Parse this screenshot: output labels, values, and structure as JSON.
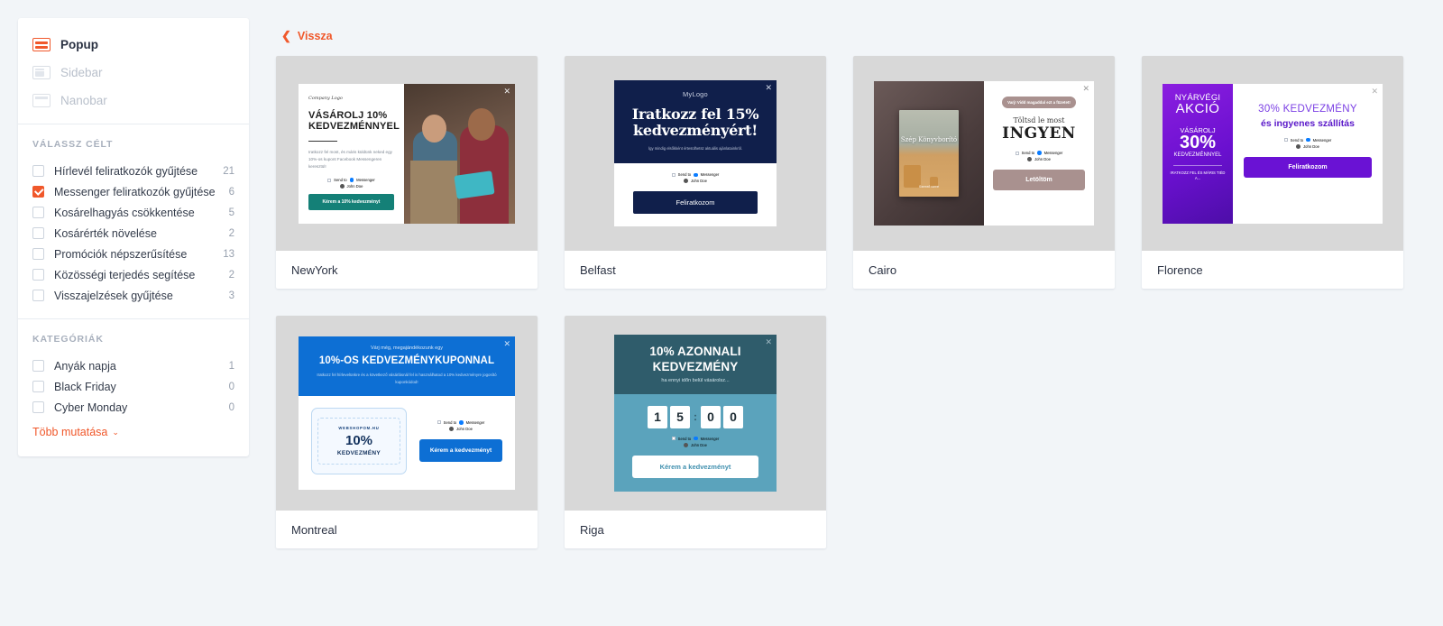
{
  "sidebar": {
    "types": [
      {
        "label": "Popup",
        "icon": "popup-icon",
        "active": true
      },
      {
        "label": "Sidebar",
        "icon": "sidebar-icon",
        "active": false
      },
      {
        "label": "Nanobar",
        "icon": "nanobar-icon",
        "active": false
      }
    ],
    "goal_group": {
      "title": "VÁLASSZ CÉLT",
      "items": [
        {
          "label": "Hírlevél feliratkozók gyűjtése",
          "count": "21",
          "checked": false
        },
        {
          "label": "Messenger feliratkozók gyűjtése",
          "count": "6",
          "checked": true
        },
        {
          "label": "Kosárelhagyás csökkentése",
          "count": "5",
          "checked": false
        },
        {
          "label": "Kosárérték növelése",
          "count": "2",
          "checked": false
        },
        {
          "label": "Promóciók népszerűsítése",
          "count": "13",
          "checked": false
        },
        {
          "label": "Közösségi terjedés segítése",
          "count": "2",
          "checked": false
        },
        {
          "label": "Visszajelzések gyűjtése",
          "count": "3",
          "checked": false
        }
      ]
    },
    "category_group": {
      "title": "KATEGÓRIÁK",
      "items": [
        {
          "label": "Anyák napja",
          "count": "1",
          "checked": false
        },
        {
          "label": "Black Friday",
          "count": "0",
          "checked": false
        },
        {
          "label": "Cyber Monday",
          "count": "0",
          "checked": false
        }
      ],
      "show_more": "Több mutatása",
      "show_more_caret": "⌄"
    }
  },
  "main": {
    "back_label": "Vissza",
    "back_chevron": "❮",
    "close_glyph": "✕"
  },
  "templates": {
    "newyork": {
      "name": "NewYork",
      "logo": "Company Logo",
      "heading": "VÁSÁROLJ 10% KEDVEZMÉNNYEL",
      "paragraph": "Iratkozz fel most, és máris küldünk neked egy 10%-os kupont Facebook Messengeren keresztül!",
      "button": "Kérem a 10% kedvezményt",
      "messenger_label": "Send to",
      "messenger_brand": "Messenger",
      "user_name": "John Doe",
      "button_color": "#148077"
    },
    "belfast": {
      "name": "Belfast",
      "logo": "MyLogo",
      "heading": "Iratkozz fel 15% kedvezményért!",
      "paragraph": "Így mindig elsőkként értesülhetsz aktuális ajánlatainkról.",
      "button": "Feliratkozom",
      "messenger_label": "Send to",
      "messenger_brand": "Messenger",
      "user_name": "John Doe",
      "bg_color": "#101f4b"
    },
    "cairo": {
      "name": "Cairo",
      "book_title": "Szép Könyvborító",
      "book_author": "Szerző neve",
      "badge": "Varj! Vidd magaddal ezt a füzetet!",
      "subheading": "Töltsd le most",
      "heading": "INGYEN",
      "button": "Letöltöm",
      "messenger_label": "Send to",
      "messenger_brand": "Messenger",
      "user_name": "John Doe",
      "accent_color": "#a9918f"
    },
    "florence": {
      "name": "Florence",
      "side_line1": "NYÁRVÉGI",
      "side_line2": "AKCIÓ",
      "side_line3": "VÁSÁROLJ",
      "side_line4": "30%",
      "side_line5": "KEDVEZMÉNNYEL",
      "side_line6": "IRATKOZZ FEL ÉS MÁRIS TIÉD A...",
      "heading": "30% KEDVEZMÉNY",
      "subheading": "és ingyenes szállítás",
      "button": "Feliratkozom",
      "messenger_label": "Send to",
      "messenger_brand": "Messenger",
      "user_name": "John Doe",
      "accent_color": "#6a12d4"
    },
    "montreal": {
      "name": "Montreal",
      "pretext": "Várj még, megajándékozunk egy",
      "heading": "10%-OS KEDVEZMÉNYKUPONNAL",
      "paragraph": "Iratkozz fel hírlevelünkre és a következő vásárlásnál fel is használhatod a 10% kedvezményre jogosító kuponkódod!",
      "coupon_brand": "WEBSHOPOM.HU",
      "coupon_value": "10%",
      "coupon_label": "KEDVEZMÉNY",
      "button": "Kérem a kedvezményt",
      "messenger_label": "Send to",
      "messenger_brand": "Messenger",
      "user_name": "John Doe",
      "accent_color": "#0d6fd4"
    },
    "riga": {
      "name": "Riga",
      "heading": "10% AZONNALI KEDVEZMÉNY",
      "paragraph": "ha ennyi időn belül vásárolsz...",
      "digits": [
        "1",
        "5",
        "0",
        "0"
      ],
      "separator": ":",
      "button": "Kérem a kedvezményt",
      "messenger_label": "Send to",
      "messenger_brand": "Messenger",
      "user_name": "John Doe",
      "accent_color": "#5ba3bc"
    }
  }
}
